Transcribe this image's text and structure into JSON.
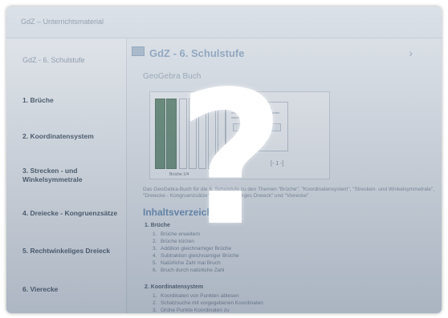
{
  "topbar": {
    "breadcrumb": "GdZ – Unterrichtsmaterial"
  },
  "sidebar": {
    "title": "GdZ - 6. Schulstufe",
    "items": [
      {
        "label": "1. Brüche"
      },
      {
        "label": "2. Koordinatensystem"
      },
      {
        "label": "3. Strecken - und Winkelsymmetrale"
      },
      {
        "label": "4. Dreiecke - Kongruenzsätze"
      },
      {
        "label": "5. Rechtwinkeliges Dreieck"
      },
      {
        "label": "6. Vierecke"
      }
    ]
  },
  "main": {
    "title": "GdZ - 6. Schulstufe",
    "subtitle": "GeoGebra Buch",
    "preview_caption": "Brüche 1/4",
    "preview_fraction": "[- 1 -]",
    "description": "Das GeoGebra-Buch für die 6. Schulstufe zu den Themen \"Brüche\", \"Koordinatensystem\", \"Strecken- und Winkelsymmetrale\", \"Dreiecke - Kongruenzsätze\", \"Rechtwinkeliges Dreieck\" und \"Vierecke\"",
    "toc_title": "Inhaltsverzeichnis",
    "toc": [
      {
        "heading": "1. Brüche",
        "items": [
          {
            "n": "1.",
            "label": "Brüche erweitern"
          },
          {
            "n": "2.",
            "label": "Brüche kürzen"
          },
          {
            "n": "3.",
            "label": "Addition gleichnamiger Brüche"
          },
          {
            "n": "4.",
            "label": "Subtraktion gleichnamiger Brüche"
          },
          {
            "n": "5.",
            "label": "Natürliche Zahl mal Bruch"
          },
          {
            "n": "6.",
            "label": "Bruch durch natürliche Zahl"
          }
        ]
      },
      {
        "heading": "2. Koordinatensystem",
        "items": [
          {
            "n": "1.",
            "label": "Koordinaten von Punkten ablesen"
          },
          {
            "n": "2.",
            "label": "Schatzsuche mit vorgegebenen Koordinaten"
          },
          {
            "n": "3.",
            "label": "Ordne Punkte Koordinaten zu"
          }
        ]
      }
    ]
  },
  "overlay": {
    "glyph": "?"
  },
  "colors": {
    "accent": "#6e93b9",
    "frame_bg": "#eef1f4",
    "bar": "#6f927b",
    "overlay": "#3c506e"
  }
}
